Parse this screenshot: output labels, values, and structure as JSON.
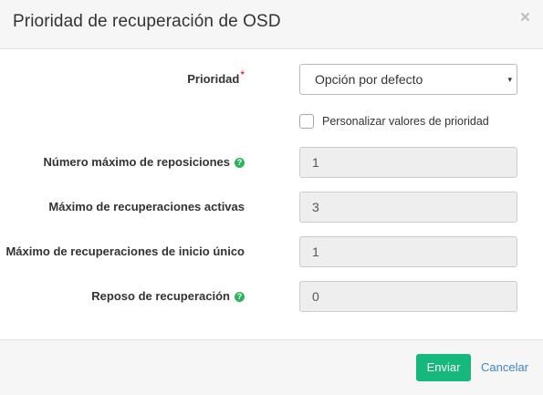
{
  "dialog": {
    "title": "Prioridad de recuperación de OSD",
    "close_symbol": "×"
  },
  "form": {
    "priority": {
      "label": "Prioridad",
      "required_mark": "*",
      "selected": "Opción por defecto",
      "caret": "▾"
    },
    "customize_checkbox": {
      "label": "Personalizar valores de prioridad",
      "checked": false
    },
    "fields": [
      {
        "label": "Número máximo de reposiciones",
        "value": "1",
        "has_help": true,
        "help_icon": "question-circle"
      },
      {
        "label": "Máximo de recuperaciones activas",
        "value": "3",
        "has_help": false
      },
      {
        "label": "Máximo de recuperaciones de inicio único",
        "value": "1",
        "has_help": false
      },
      {
        "label": "Reposo de recuperación",
        "value": "0",
        "has_help": true,
        "help_icon": "question-circle"
      }
    ],
    "help_symbol": "?"
  },
  "footer": {
    "submit_label": "Enviar",
    "cancel_label": "Cancelar"
  },
  "colors": {
    "primary_button": "#16b87d",
    "help_icon": "#2db35d",
    "link": "#3f85c8",
    "required": "#cc0000"
  }
}
